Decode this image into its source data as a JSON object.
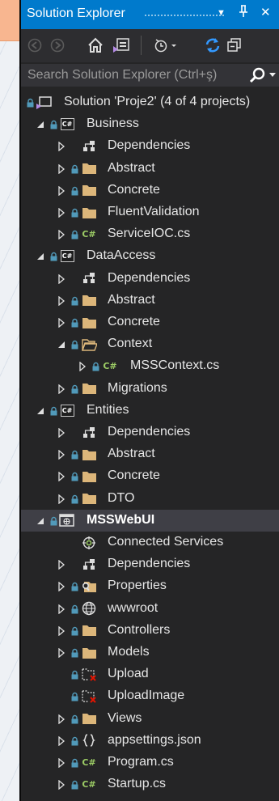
{
  "window": {
    "title": "Solution Explorer",
    "buttons": {
      "dropdown": "▼",
      "pin": "ᛘ",
      "close": "✕"
    }
  },
  "toolbar": {
    "items": [
      "back-icon",
      "forward-icon",
      "home-icon",
      "switch-views-icon",
      "pending-changes-icon",
      "refresh-icon",
      "collapse-all-icon"
    ]
  },
  "search": {
    "placeholder": "Search Solution Explorer (Ctrl+ş)",
    "value": ""
  },
  "tree": {
    "rows": [
      {
        "label": "Solution 'Proje2' (4 of 4 projects)",
        "icon": "solution-icon",
        "level": 0,
        "arrow": "none",
        "lock": true
      },
      {
        "label": "Business",
        "icon": "csharp-project-icon",
        "level": 1,
        "arrow": "expanded",
        "lock": true
      },
      {
        "label": "Dependencies",
        "icon": "dependencies-icon",
        "level": 2,
        "arrow": "collapsed",
        "lock": false
      },
      {
        "label": "Abstract",
        "icon": "folder-icon",
        "level": 2,
        "arrow": "collapsed",
        "lock": true
      },
      {
        "label": "Concrete",
        "icon": "folder-icon",
        "level": 2,
        "arrow": "collapsed",
        "lock": true
      },
      {
        "label": "FluentValidation",
        "icon": "folder-icon",
        "level": 2,
        "arrow": "collapsed",
        "lock": true
      },
      {
        "label": "ServiceIOC.cs",
        "icon": "csharp-file-icon",
        "level": 2,
        "arrow": "collapsed",
        "lock": true
      },
      {
        "label": "DataAccess",
        "icon": "csharp-project-icon",
        "level": 1,
        "arrow": "expanded",
        "lock": true
      },
      {
        "label": "Dependencies",
        "icon": "dependencies-icon",
        "level": 2,
        "arrow": "collapsed",
        "lock": false
      },
      {
        "label": "Abstract",
        "icon": "folder-icon",
        "level": 2,
        "arrow": "collapsed",
        "lock": true
      },
      {
        "label": "Concrete",
        "icon": "folder-icon",
        "level": 2,
        "arrow": "collapsed",
        "lock": true
      },
      {
        "label": "Context",
        "icon": "folder-open-icon",
        "level": 2,
        "arrow": "expanded",
        "lock": true
      },
      {
        "label": "MSSContext.cs",
        "icon": "csharp-file-icon",
        "level": 3,
        "arrow": "collapsed",
        "lock": true
      },
      {
        "label": "Migrations",
        "icon": "folder-icon",
        "level": 2,
        "arrow": "collapsed",
        "lock": true
      },
      {
        "label": "Entities",
        "icon": "csharp-project-icon",
        "level": 1,
        "arrow": "expanded",
        "lock": true
      },
      {
        "label": "Dependencies",
        "icon": "dependencies-icon",
        "level": 2,
        "arrow": "collapsed",
        "lock": false
      },
      {
        "label": "Abstract",
        "icon": "folder-icon",
        "level": 2,
        "arrow": "collapsed",
        "lock": true
      },
      {
        "label": "Concrete",
        "icon": "folder-icon",
        "level": 2,
        "arrow": "collapsed",
        "lock": true
      },
      {
        "label": "DTO",
        "icon": "folder-icon",
        "level": 2,
        "arrow": "collapsed",
        "lock": true
      },
      {
        "label": "MSSWebUI",
        "icon": "web-project-icon",
        "level": 1,
        "arrow": "expanded",
        "lock": true,
        "selected": true
      },
      {
        "label": "Connected Services",
        "icon": "connected-services-icon",
        "level": 2,
        "arrow": "none",
        "lock": false
      },
      {
        "label": "Dependencies",
        "icon": "dependencies-icon",
        "level": 2,
        "arrow": "collapsed",
        "lock": false
      },
      {
        "label": "Properties",
        "icon": "properties-folder-icon",
        "level": 2,
        "arrow": "collapsed",
        "lock": true
      },
      {
        "label": "wwwroot",
        "icon": "globe-icon",
        "level": 2,
        "arrow": "collapsed",
        "lock": true
      },
      {
        "label": "Controllers",
        "icon": "folder-icon",
        "level": 2,
        "arrow": "collapsed",
        "lock": true
      },
      {
        "label": "Models",
        "icon": "folder-icon",
        "level": 2,
        "arrow": "collapsed",
        "lock": true
      },
      {
        "label": "Upload",
        "icon": "excluded-folder-icon",
        "level": 2,
        "arrow": "none",
        "lock": true
      },
      {
        "label": "UploadImage",
        "icon": "excluded-folder-icon",
        "level": 2,
        "arrow": "none",
        "lock": true
      },
      {
        "label": "Views",
        "icon": "folder-icon",
        "level": 2,
        "arrow": "collapsed",
        "lock": true
      },
      {
        "label": "appsettings.json",
        "icon": "json-file-icon",
        "level": 2,
        "arrow": "collapsed",
        "lock": true
      },
      {
        "label": "Program.cs",
        "icon": "csharp-file-icon",
        "level": 2,
        "arrow": "collapsed",
        "lock": true
      },
      {
        "label": "Startup.cs",
        "icon": "csharp-file-icon",
        "level": 2,
        "arrow": "collapsed",
        "lock": true
      }
    ]
  },
  "colors": {
    "title_bar": "#007acc",
    "panel_bg": "#252526",
    "selection": "#3f3f46",
    "folder": "#dcb67a",
    "lock": "#519aba",
    "csharp": "#9ccc65"
  }
}
